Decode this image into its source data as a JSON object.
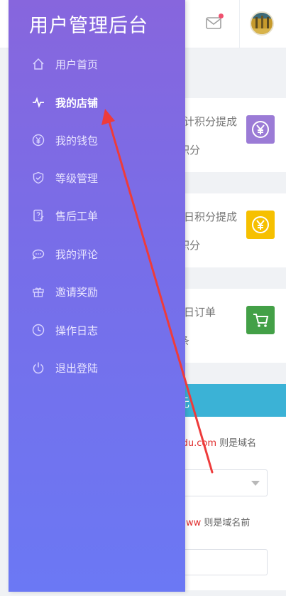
{
  "app": {
    "title": "用户管理后台"
  },
  "sidebar": {
    "items": [
      {
        "label": "用户首页",
        "icon": "home-icon"
      },
      {
        "label": "我的店铺",
        "icon": "pulse-icon",
        "active": true
      },
      {
        "label": "我的钱包",
        "icon": "yen-circle-icon"
      },
      {
        "label": "等级管理",
        "icon": "shield-check-icon"
      },
      {
        "label": "售后工单",
        "icon": "ticket-icon"
      },
      {
        "label": "我的评论",
        "icon": "comment-icon"
      },
      {
        "label": "邀请奖励",
        "icon": "gift-icon"
      },
      {
        "label": "操作日志",
        "icon": "clock-icon"
      },
      {
        "label": "退出登陆",
        "icon": "power-icon"
      }
    ]
  },
  "stats": [
    {
      "title": "累计积分提成",
      "sub": "积分",
      "icon": "yen-icon",
      "color": "#9b7bd6"
    },
    {
      "title": "今日积分提成",
      "sub": "积分",
      "icon": "yen-icon",
      "color": "#f6c000"
    },
    {
      "title": "今日订单",
      "sub": "条",
      "icon": "cart-icon",
      "color": "#43a047"
    }
  ],
  "panel": {
    "header": "元",
    "tip1": {
      "red": "idu.com",
      "text": " 则是域名"
    },
    "tip2": {
      "red": "ww",
      "text": " 则是域名前"
    }
  },
  "colors": {
    "accent": "#3bb2d6",
    "arrow": "#ee3b3b"
  }
}
